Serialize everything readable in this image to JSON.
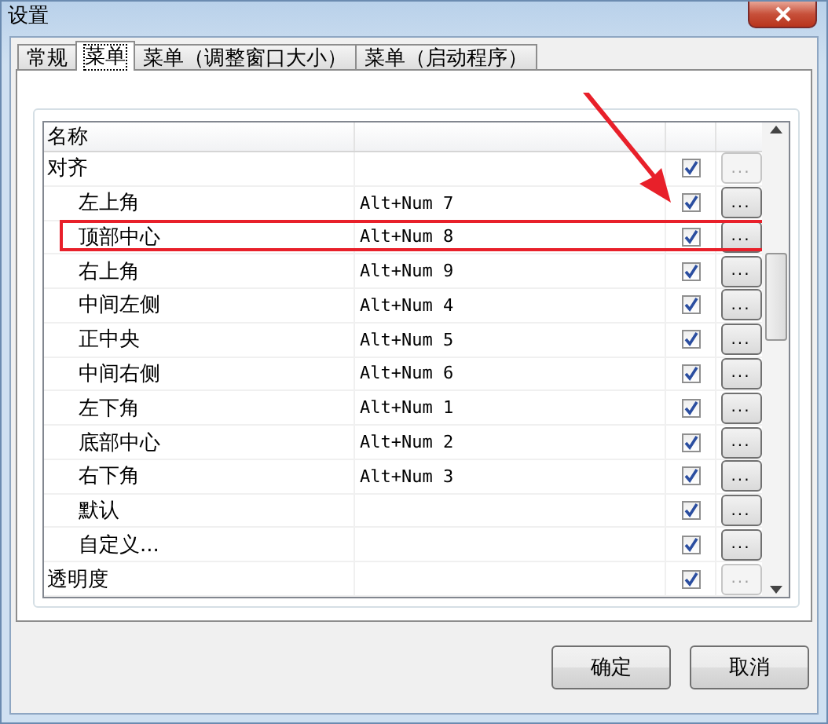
{
  "window": {
    "title": "设置"
  },
  "tabs": [
    {
      "label": "常规",
      "selected": false
    },
    {
      "label": "菜单",
      "selected": true
    },
    {
      "label": "菜单（调整窗口大小）",
      "selected": false
    },
    {
      "label": "菜单（启动程序）",
      "selected": false
    }
  ],
  "table": {
    "columns": [
      "名称"
    ],
    "rows": [
      {
        "name": "对齐",
        "checked": true,
        "button": "...",
        "button_disabled": true,
        "highlighted": false,
        "children": [
          {
            "name": "左上角",
            "shortcut": "Alt+Num 7",
            "checked": true,
            "button": "...",
            "button_disabled": false,
            "highlighted": false
          },
          {
            "name": "顶部中心",
            "shortcut": "Alt+Num 8",
            "checked": true,
            "button": "...",
            "button_disabled": false,
            "highlighted": true
          },
          {
            "name": "右上角",
            "shortcut": "Alt+Num 9",
            "checked": true,
            "button": "...",
            "button_disabled": false,
            "highlighted": false
          },
          {
            "name": "中间左侧",
            "shortcut": "Alt+Num 4",
            "checked": true,
            "button": "...",
            "button_disabled": false,
            "highlighted": false
          },
          {
            "name": "正中央",
            "shortcut": "Alt+Num 5",
            "checked": true,
            "button": "...",
            "button_disabled": false,
            "highlighted": false
          },
          {
            "name": "中间右侧",
            "shortcut": "Alt+Num 6",
            "checked": true,
            "button": "...",
            "button_disabled": false,
            "highlighted": false
          },
          {
            "name": "左下角",
            "shortcut": "Alt+Num 1",
            "checked": true,
            "button": "...",
            "button_disabled": false,
            "highlighted": false
          },
          {
            "name": "底部中心",
            "shortcut": "Alt+Num 2",
            "checked": true,
            "button": "...",
            "button_disabled": false,
            "highlighted": false
          },
          {
            "name": "右下角",
            "shortcut": "Alt+Num 3",
            "checked": true,
            "button": "...",
            "button_disabled": false,
            "highlighted": false
          },
          {
            "name": "默认",
            "checked": true,
            "button": "...",
            "button_disabled": false,
            "highlighted": false
          },
          {
            "name": "自定义...",
            "checked": true,
            "button": "...",
            "button_disabled": false,
            "highlighted": false
          }
        ]
      },
      {
        "name": "透明度",
        "checked": true,
        "button": "...",
        "button_disabled": true,
        "highlighted": false
      }
    ]
  },
  "buttons": [
    "确定",
    "取消"
  ]
}
